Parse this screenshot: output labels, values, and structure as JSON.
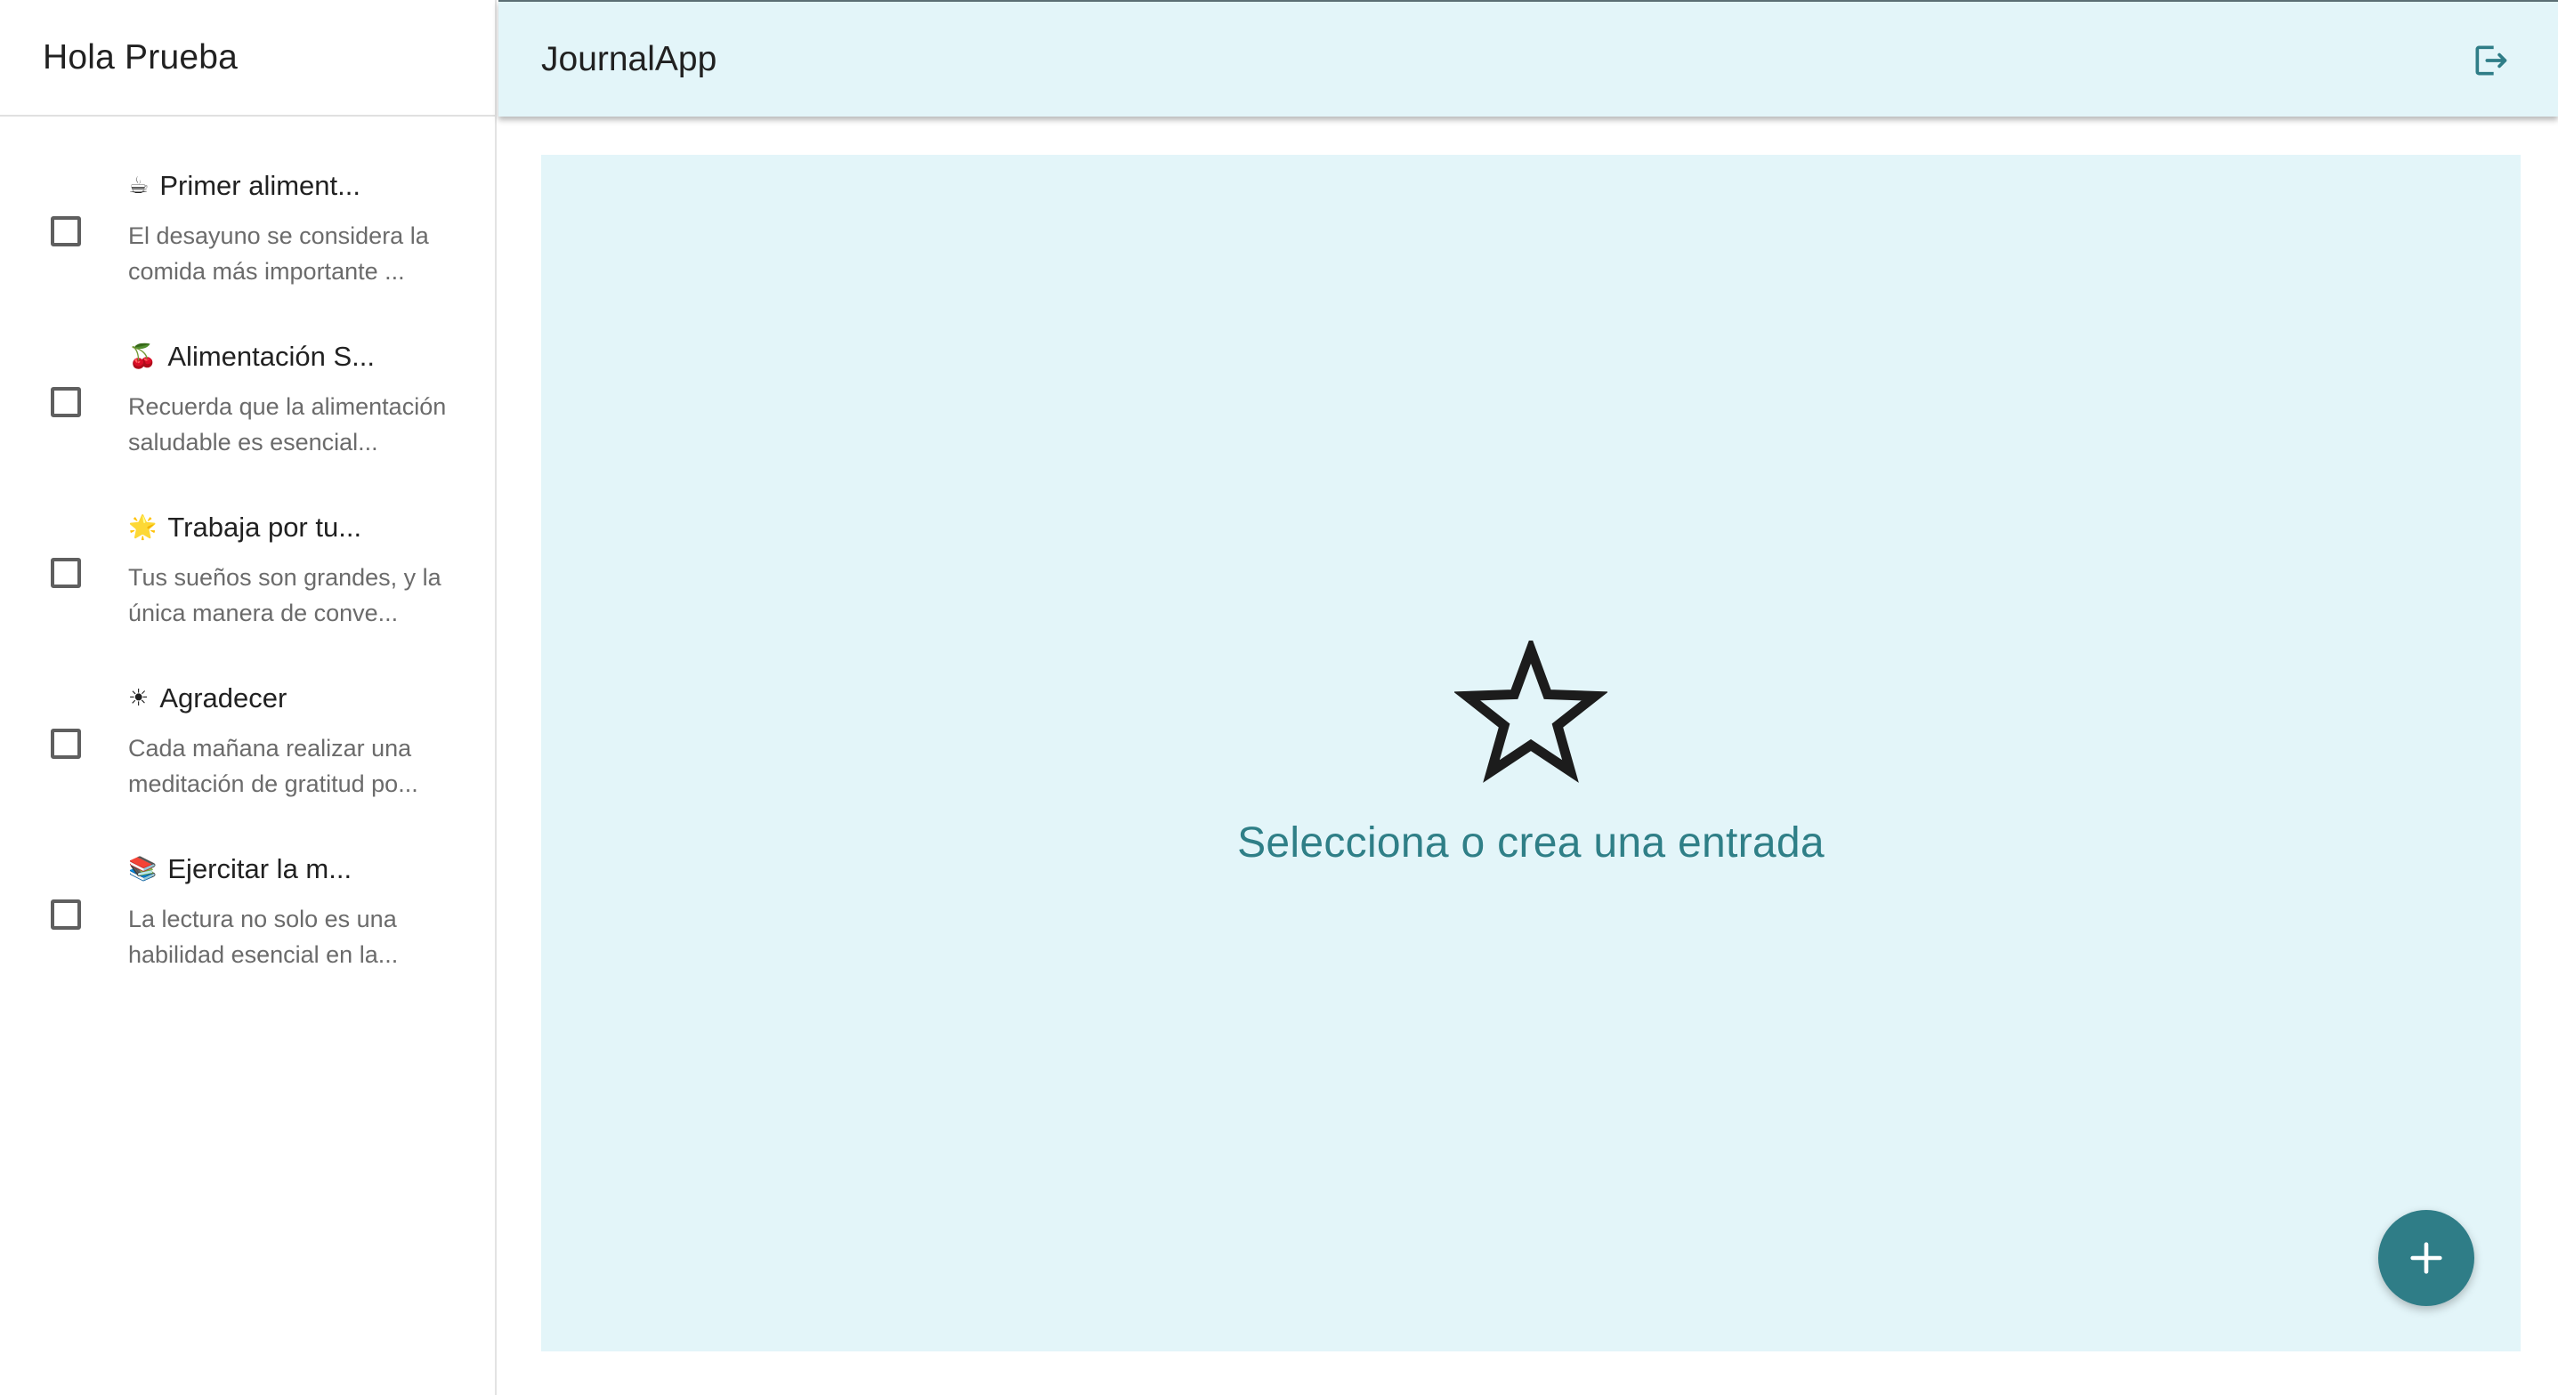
{
  "sidebar": {
    "greeting": "Hola Prueba",
    "entries": [
      {
        "emoji": "☕",
        "title": "Primer aliment...",
        "body": "El desayuno se considera la comida más importante ..."
      },
      {
        "emoji": "🍒",
        "title": "Alimentación S...",
        "body": "Recuerda que la alimentación saludable es esencial..."
      },
      {
        "emoji": "🌟",
        "title": "Trabaja por tu...",
        "body": "Tus sueños son grandes, y la única manera de conve..."
      },
      {
        "emoji": "☀",
        "title": "Agradecer",
        "body": "Cada mañana realizar una meditación de gratitud po..."
      },
      {
        "emoji": "📚",
        "title": "Ejercitar la m...",
        "body": "La lectura no solo es una habilidad esencial en la..."
      }
    ]
  },
  "appbar": {
    "title": "JournalApp",
    "logout_icon": "logout-icon"
  },
  "main": {
    "empty_icon": "star-outline-icon",
    "empty_message": "Selecciona o crea una entrada"
  },
  "fab": {
    "icon": "plus-icon"
  },
  "colors": {
    "accent": "#2f7d87",
    "panel_background": "#e3f5f9",
    "message_text": "#2f7f87"
  }
}
